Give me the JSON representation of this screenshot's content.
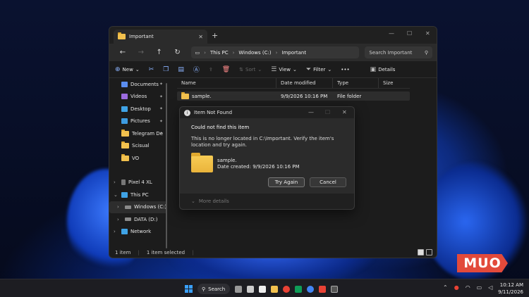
{
  "window": {
    "tab_title": "Important",
    "search_placeholder": "Search Important",
    "breadcrumb": [
      "This PC",
      "Windows (C:)",
      "Important"
    ]
  },
  "toolbar": {
    "new": "New",
    "sort": "Sort",
    "view": "View",
    "filter": "Filter",
    "more": "•••",
    "details": "Details"
  },
  "sidebar": {
    "items": [
      {
        "label": "Documents",
        "icon": "documents-icon",
        "color": "#5b8def",
        "pinned": true
      },
      {
        "label": "Videos",
        "icon": "videos-icon",
        "color": "#9c6bdf",
        "pinned": true
      },
      {
        "label": "Desktop",
        "icon": "desktop-icon",
        "color": "#3fa3e6",
        "pinned": true
      },
      {
        "label": "Pictures",
        "icon": "pictures-icon",
        "color": "#3d9be0",
        "pinned": true
      },
      {
        "label": "Telegram De",
        "icon": "folder-icon",
        "color": "#f2c14e",
        "pinned": true
      },
      {
        "label": "Scisual",
        "icon": "folder-icon",
        "color": "#f2c14e",
        "pinned": false
      },
      {
        "label": "VO",
        "icon": "folder-icon",
        "color": "#f2c14e",
        "pinned": false
      }
    ],
    "tree": [
      {
        "label": "Pixel 4 XL",
        "icon": "phone-icon"
      },
      {
        "label": "This PC",
        "icon": "computer-icon"
      },
      {
        "label": "Windows (C:)",
        "icon": "drive-icon"
      },
      {
        "label": "DATA (D:)",
        "icon": "drive-icon"
      },
      {
        "label": "Network",
        "icon": "network-icon"
      }
    ]
  },
  "columns": {
    "name": "Name",
    "date": "Date modified",
    "type": "Type",
    "size": "Size"
  },
  "files": [
    {
      "name": "sample.",
      "date": "9/9/2026 10:16 PM",
      "type": "File folder"
    }
  ],
  "status": {
    "count": "1 item",
    "selected": "1 item selected"
  },
  "dialog": {
    "title": "Item Not Found",
    "heading": "Could not find this item",
    "message": "This is no longer located in C:\\Important. Verify the item's location and try again.",
    "item_name": "sample.",
    "item_date": "Date created: 9/9/2026 10:16 PM",
    "try_again": "Try Again",
    "cancel": "Cancel",
    "more_details": "More details"
  },
  "taskbar": {
    "search": "Search",
    "time": "10:12 AM",
    "date": "9/11/2026"
  },
  "watermark": "MUO",
  "colors": {
    "accent": "#3aa0ff",
    "folder": "#f2c14e",
    "watermark": "#e24a3b"
  }
}
